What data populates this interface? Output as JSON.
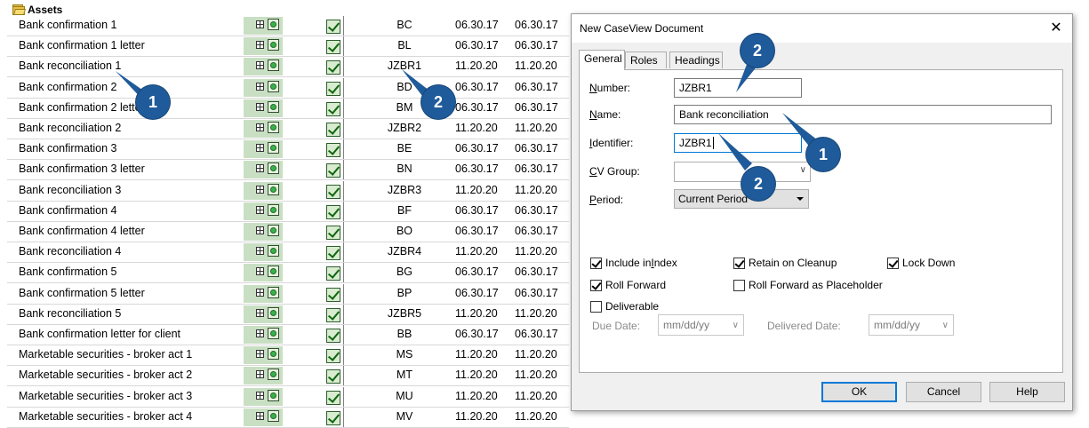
{
  "list": {
    "group": "Assets",
    "rows": [
      {
        "name": "Bank confirmation 1",
        "code": "BC",
        "date1": "06.30.17",
        "date2": "06.30.17"
      },
      {
        "name": "Bank confirmation 1 letter",
        "code": "BL",
        "date1": "06.30.17",
        "date2": "06.30.17"
      },
      {
        "name": "Bank reconciliation 1",
        "code": "JZBR1",
        "date1": "11.20.20",
        "date2": "11.20.20"
      },
      {
        "name": "Bank confirmation 2",
        "code": "BD",
        "date1": "06.30.17",
        "date2": "06.30.17"
      },
      {
        "name": "Bank confirmation 2 letter",
        "code": "BM",
        "date1": "06.30.17",
        "date2": "06.30.17"
      },
      {
        "name": "Bank reconciliation 2",
        "code": "JZBR2",
        "date1": "11.20.20",
        "date2": "11.20.20"
      },
      {
        "name": "Bank confirmation 3",
        "code": "BE",
        "date1": "06.30.17",
        "date2": "06.30.17"
      },
      {
        "name": "Bank confirmation 3 letter",
        "code": "BN",
        "date1": "06.30.17",
        "date2": "06.30.17"
      },
      {
        "name": "Bank reconciliation 3",
        "code": "JZBR3",
        "date1": "11.20.20",
        "date2": "11.20.20"
      },
      {
        "name": "Bank confirmation 4",
        "code": "BF",
        "date1": "06.30.17",
        "date2": "06.30.17"
      },
      {
        "name": "Bank confirmation 4 letter",
        "code": "BO",
        "date1": "06.30.17",
        "date2": "06.30.17"
      },
      {
        "name": "Bank reconciliation 4",
        "code": "JZBR4",
        "date1": "11.20.20",
        "date2": "11.20.20"
      },
      {
        "name": "Bank confirmation 5",
        "code": "BG",
        "date1": "06.30.17",
        "date2": "06.30.17"
      },
      {
        "name": "Bank confirmation 5 letter",
        "code": "BP",
        "date1": "06.30.17",
        "date2": "06.30.17"
      },
      {
        "name": "Bank reconciliation 5",
        "code": "JZBR5",
        "date1": "11.20.20",
        "date2": "11.20.20"
      },
      {
        "name": "Bank confirmation letter for client",
        "code": "BB",
        "date1": "06.30.17",
        "date2": "06.30.17"
      },
      {
        "name": "Marketable securities - broker act 1",
        "code": "MS",
        "date1": "11.20.20",
        "date2": "11.20.20"
      },
      {
        "name": "Marketable securities - broker act 2",
        "code": "MT",
        "date1": "11.20.20",
        "date2": "11.20.20"
      },
      {
        "name": "Marketable securities - broker act 3",
        "code": "MU",
        "date1": "11.20.20",
        "date2": "11.20.20"
      },
      {
        "name": "Marketable securities - broker act 4",
        "code": "MV",
        "date1": "11.20.20",
        "date2": "11.20.20"
      }
    ]
  },
  "callouts": {
    "one": "1",
    "two": "2"
  },
  "dialog": {
    "title": "New CaseView Document",
    "close": "✕",
    "tabs": {
      "general": "General",
      "roles": "Roles",
      "headings": "Headings"
    },
    "number": {
      "label_u": "N",
      "label_rest": "umber:",
      "value": "JZBR1"
    },
    "name": {
      "label_u": "N",
      "label_rest": "ame:",
      "value": "Bank reconciliation"
    },
    "identifier": {
      "label_u": "I",
      "label_rest": "dentifier:",
      "value": "JZBR1"
    },
    "cv_group": {
      "label_u": "C",
      "label_rest": "V Group:",
      "value": ""
    },
    "period": {
      "label_u": "P",
      "label_rest": "eriod:",
      "value": "Current Period"
    },
    "checkboxes": {
      "include_index": {
        "pre": "Include in ",
        "u": "I",
        "post": "ndex",
        "checked": true
      },
      "retain_cleanup": {
        "pre": "Retain on Cleanup",
        "u": "",
        "post": "",
        "checked": true
      },
      "lock_down": {
        "pre": "Lock Down",
        "u": "",
        "post": "",
        "checked": true
      },
      "roll_forward": {
        "pre": "Roll Forward",
        "u": "",
        "post": "",
        "checked": true
      },
      "roll_placeholder": {
        "pre": "Roll Forward as Placeholder",
        "u": "",
        "post": "",
        "checked": false
      },
      "deliverable": {
        "pre": "Deliverable",
        "u": "",
        "post": "",
        "checked": false
      }
    },
    "due_date": {
      "label": "Due Date:",
      "placeholder": "mm/dd/yy"
    },
    "delivered_date": {
      "label": "Delivered Date:",
      "placeholder": "mm/dd/yy"
    },
    "buttons": {
      "ok": "OK",
      "cancel": "Cancel",
      "help": "Help"
    }
  },
  "colors": {
    "callout": "#1f5b9a",
    "list_fill": "#c9dfc3",
    "focus": "#0078d7"
  },
  "icons": {
    "folder": "folder-icon",
    "grid": "grid-icon",
    "status": "status-dot-icon",
    "check": "checkmark-icon",
    "close": "close-icon"
  }
}
